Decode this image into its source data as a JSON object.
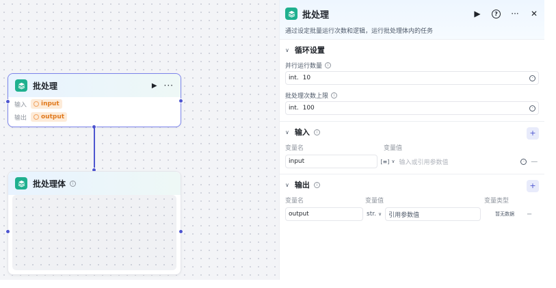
{
  "canvas": {
    "batch_node": {
      "title": "批处理",
      "run_icon": "▶",
      "more_icon": "···",
      "input_label": "输入",
      "input_value": "input",
      "output_label": "输出",
      "output_value": "output"
    },
    "body_node": {
      "title": "批处理体",
      "info_icon": "i"
    }
  },
  "panel": {
    "title": "批处理",
    "run_icon": "▶",
    "help_icon": "?",
    "more_icon": "···",
    "close_icon": "✕",
    "description": "通过设定批量运行次数和逻辑，运行批处理体内的任务",
    "loop": {
      "title": "循环设置",
      "parallel_label": "并行运行数量",
      "parallel_type": "int.",
      "parallel_value": "10",
      "limit_label": "批处理次数上限",
      "limit_type": "int.",
      "limit_value": "100"
    },
    "inputs": {
      "title": "输入",
      "add_label": "+",
      "col_name": "变量名",
      "col_value": "变量值",
      "row_name": "input",
      "row_type": "[≡]",
      "row_value_placeholder": "输入或引用参数值",
      "remove_label": "—"
    },
    "outputs": {
      "title": "输出",
      "add_label": "+",
      "col_name": "变量名",
      "col_value": "变量值",
      "col_type": "变量类型",
      "row_name": "output",
      "row_type": "str.",
      "row_value": "引用参数值",
      "row_var_type": "暂无数据",
      "remove_label": "−"
    }
  },
  "colors": {
    "accent": "#4d55cf",
    "node_icon": "#1fb08f",
    "pill_bg": "#fdebd8",
    "pill_text": "#e0791d"
  }
}
